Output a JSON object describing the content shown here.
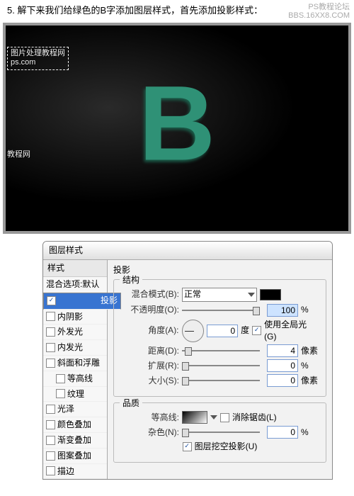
{
  "step": "5. 解下来我们给绿色的B字添加图层样式，首先添加投影样式：",
  "corner": {
    "l1": "PS教程论坛",
    "l2": "BBS.16XX8.COM"
  },
  "wm": {
    "l1": "图片处理教程网",
    "l2": "ps.com",
    "l3": "教程网"
  },
  "letter": "B",
  "dlg_title": "图层样式",
  "side_header": "样式",
  "blend_defaults": "混合选项:默认",
  "effects": {
    "dropshadow": "投影",
    "innershadow": "内阴影",
    "outerglow": "外发光",
    "innerglow": "内发光",
    "bevel": "斜面和浮雕",
    "contour": "等高线",
    "texture": "纹理",
    "satin": "光泽",
    "coloroverlay": "颜色叠加",
    "gradientoverlay": "渐变叠加",
    "patternoverlay": "图案叠加",
    "stroke": "描边"
  },
  "panel": {
    "title": "投影",
    "group_struct": "结构",
    "blendmode_lbl": "混合模式(B):",
    "blendmode_val": "正常",
    "opacity_lbl": "不透明度(O):",
    "opacity_val": "100",
    "pct": "%",
    "angle_lbl": "角度(A):",
    "angle_val": "0",
    "deg": "度",
    "global_lbl": "使用全局光(G)",
    "distance_lbl": "距离(D):",
    "distance_val": "4",
    "px": "像素",
    "spread_lbl": "扩展(R):",
    "spread_val": "0",
    "size_lbl": "大小(S):",
    "size_val": "0",
    "group_quality": "品质",
    "contour_lbl": "等高线:",
    "aa_lbl": "消除锯齿(L)",
    "noise_lbl": "杂色(N):",
    "noise_val": "0",
    "knockout_lbl": "图层挖空投影(U)"
  }
}
